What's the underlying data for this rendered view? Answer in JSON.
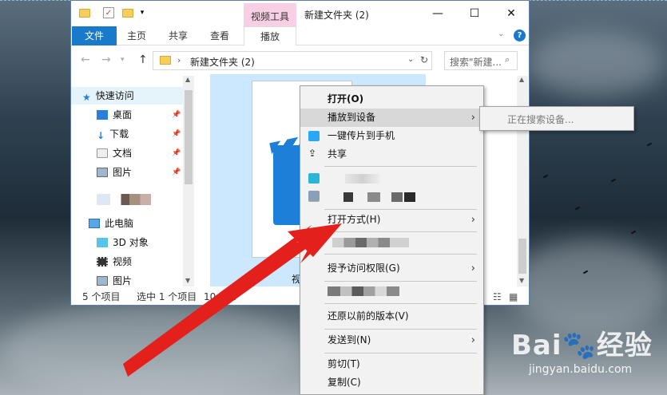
{
  "window": {
    "title": "新建文件夹 (2)",
    "contextual_tab_title": "视频工具",
    "minimize": "—",
    "maximize": "☐",
    "close": "✕"
  },
  "ribbon": {
    "tabs": [
      "文件",
      "主页",
      "共享",
      "查看",
      "播放"
    ],
    "help": "?"
  },
  "address": {
    "path": "新建文件夹 (2)",
    "separator": "›",
    "search_placeholder": "搜索\"新建..."
  },
  "nav": {
    "items": [
      "快速访问",
      "桌面",
      "下载",
      "文档",
      "图片",
      "此电脑",
      "3D 对象",
      "视频",
      "图片"
    ]
  },
  "file": {
    "partial_name": "视"
  },
  "status": {
    "count": "5 个项目",
    "selected": "选中 1 个项目",
    "size": "10.4 M"
  },
  "context_menu": {
    "open": "打开(O)",
    "cast": "播放到设备",
    "send_phone": "一键传片到手机",
    "share": "共享",
    "open_with": "打开方式(H)",
    "grant_access": "授予访问权限(G)",
    "restore": "还原以前的版本(V)",
    "send_to": "发送到(N)",
    "cut": "剪切(T)",
    "copy": "复制(C)",
    "submenu_arrow": "›"
  },
  "submenu": {
    "searching": "正在搜索设备..."
  },
  "watermark": {
    "brand": "Bai🐾经验",
    "url": "jingyan.baidu.com"
  },
  "colors": {
    "file_tab": "#1979ca",
    "contextual_tab": "#f8cfe4",
    "selection": "#cce8ff",
    "arrow": "#e3201b"
  }
}
